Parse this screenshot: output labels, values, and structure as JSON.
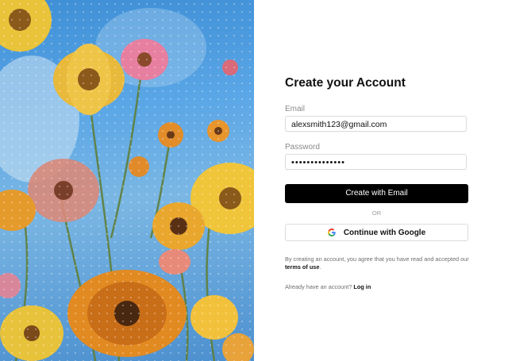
{
  "signup": {
    "title": "Create your Account",
    "email_label": "Email",
    "email_value": "alexsmith123@gmail.com",
    "password_label": "Password",
    "password_value": "••••••••••••••",
    "create_button": "Create with Email",
    "divider": "OR",
    "google_button": "Continue with Google",
    "terms_prefix": "By creating an account, you agree that you have read and accepted our ",
    "terms_link": "terms of use",
    "terms_suffix": ".",
    "login_prompt": "Already have an account? ",
    "login_link": "Log in"
  },
  "colors": {
    "primary_button": "#000000",
    "sky": "#4d90cf"
  },
  "icons": {
    "google": "google-icon"
  }
}
